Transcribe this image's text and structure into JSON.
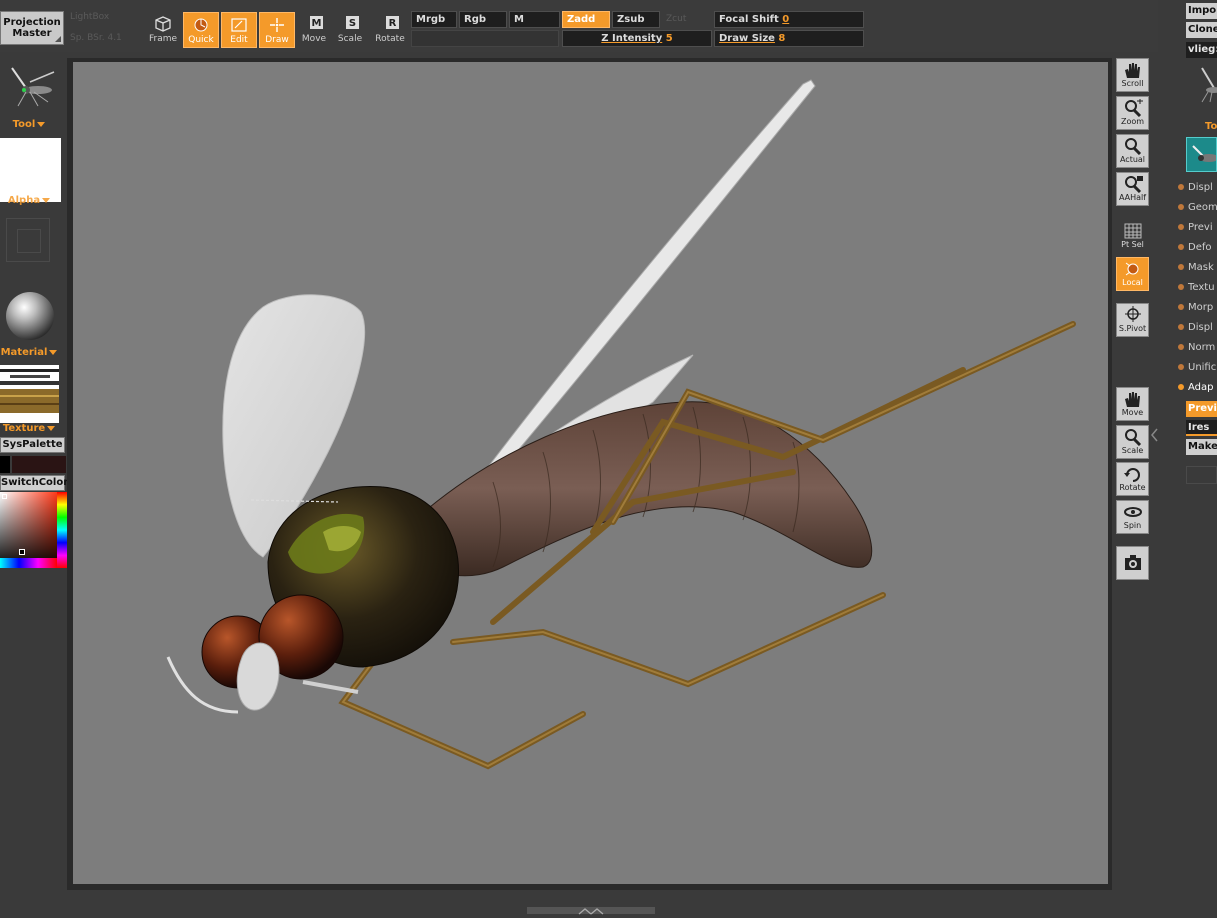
{
  "toolbar": {
    "projection_master": "Projection Master",
    "faint_top": [
      "LightBox",
      "LightBox",
      "Sp. BSr. 4.1",
      "Sp. BSr. 4.1"
    ],
    "buttons": [
      {
        "label": "Frame",
        "icon": "cube-icon",
        "active": false
      },
      {
        "label": "Quick",
        "icon": "quick-icon",
        "active": true
      },
      {
        "label": "Edit",
        "icon": "edit-icon",
        "active": true
      },
      {
        "label": "Draw",
        "icon": "draw-icon",
        "active": true
      },
      {
        "label": "Move",
        "icon": "move-icon",
        "active": false
      },
      {
        "label": "Scale",
        "icon": "scale-icon",
        "active": false
      },
      {
        "label": "Rotate",
        "icon": "rotate-icon",
        "active": false
      }
    ],
    "move_key": "M",
    "scale_key": "S",
    "rotate_key": "R",
    "mrgb": "Mrgb",
    "rgb": "Rgb",
    "m": "M",
    "zadd": "Zadd",
    "zsub": "Zsub",
    "zcut_faint": "Zcut",
    "focal_shift_label": "Focal Shift",
    "focal_shift_value": "0",
    "z_intensity_label": "Z Intensity",
    "z_intensity_value": "5",
    "draw_size_label": "Draw Size",
    "draw_size_value": "8"
  },
  "left_panel": {
    "tool_label": "Tool",
    "alpha_label": "Alpha",
    "material_label": "Material",
    "texture_label": "Texture",
    "syspalette_label": "SysPalette",
    "switchcolor_label": "SwitchColor"
  },
  "view_tools": [
    {
      "label": "Scroll",
      "icon": "hand-icon"
    },
    {
      "label": "Zoom",
      "icon": "zoom-icon"
    },
    {
      "label": "Actual",
      "icon": "actual-icon"
    },
    {
      "label": "AAHalf",
      "icon": "aahalf-icon"
    },
    {
      "label": "Pt Sel",
      "icon": "grid-icon"
    },
    {
      "label": "Local",
      "icon": "local-icon"
    },
    {
      "label": "S.Pivot",
      "icon": "pivot-icon"
    },
    {
      "label": "Move",
      "icon": "hand-icon"
    },
    {
      "label": "Scale",
      "icon": "zoom-icon"
    },
    {
      "label": "Rotate",
      "icon": "rotate-icon"
    },
    {
      "label": "Spin",
      "icon": "spin-icon"
    }
  ],
  "right_panel": {
    "import": "Impo",
    "clone": "Clone",
    "tool_name": "vlieg:",
    "tool_label": "To",
    "items": [
      "Displ",
      "Geom",
      "Previ",
      "Defo",
      "Mask",
      "Textu",
      "Morp",
      "Displ",
      "Norm",
      "Unific",
      "Adap"
    ],
    "preview_btn": "Previ",
    "ires_btn": "Ires",
    "make_btn": "Make"
  },
  "colors": {
    "accent": "#f49a2a",
    "canvas_bg": "#7d7d7d",
    "ui_bg": "#3a3a3a"
  }
}
